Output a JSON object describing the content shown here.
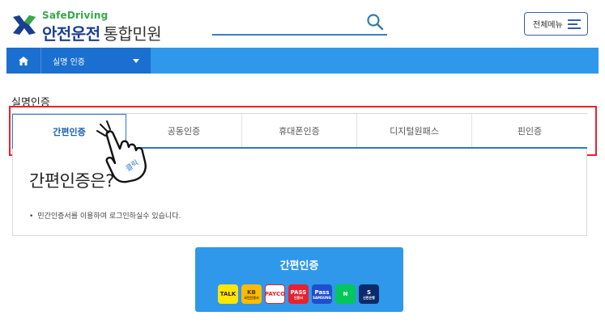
{
  "header": {
    "logo_small": "SafeDriving",
    "logo_main": "안전운전",
    "logo_sub": "통합민원",
    "search_value": "",
    "menu_label": "전체메뉴"
  },
  "nav": {
    "breadcrumb_label": "실명 인증"
  },
  "page": {
    "title": "실명인증"
  },
  "tabs": [
    {
      "label": "간편인증",
      "active": true
    },
    {
      "label": "공동인증",
      "active": false
    },
    {
      "label": "휴대폰인증",
      "active": false
    },
    {
      "label": "디지털원패스",
      "active": false
    },
    {
      "label": "핀인증",
      "active": false
    }
  ],
  "content": {
    "heading": "간편인증은?",
    "bullet": "민간인증서를 이용하여 로그인하실수 있습니다."
  },
  "hand_annotation": "클릭",
  "auth_button": {
    "label": "간편인증"
  },
  "providers": [
    {
      "name": "kakao-talk-icon",
      "main": "TALK",
      "sub": "",
      "bg": "#ffe600",
      "fg": "#3b1e1e"
    },
    {
      "name": "kb-icon",
      "main": "KB",
      "sub": "국민인증서",
      "bg": "#ffbc00",
      "fg": "#4a3b00"
    },
    {
      "name": "payco-icon",
      "main": "PAYCO",
      "sub": "",
      "bg": "#ffffff",
      "fg": "#e8202f"
    },
    {
      "name": "pass-icon",
      "main": "PASS",
      "sub": "인증서",
      "bg": "#e8202f",
      "fg": "#ffffff"
    },
    {
      "name": "samsung-pass-icon",
      "main": "Pass",
      "sub": "SAMSUNG",
      "bg": "#1f4fcf",
      "fg": "#ffffff"
    },
    {
      "name": "naver-icon",
      "main": "N",
      "sub": "",
      "bg": "#03c75a",
      "fg": "#ffffff"
    },
    {
      "name": "shinhan-icon",
      "main": "S",
      "sub": "신한은행",
      "bg": "#0b2a6b",
      "fg": "#ffffff"
    }
  ],
  "colors": {
    "primary_blue": "#2f98ea",
    "nav_dark_blue": "#1a6fd0",
    "highlight_red": "#e8202f",
    "tab_active_blue": "#1a5fb0",
    "logo_green": "#36a94a",
    "logo_navy": "#1b3e8f"
  }
}
